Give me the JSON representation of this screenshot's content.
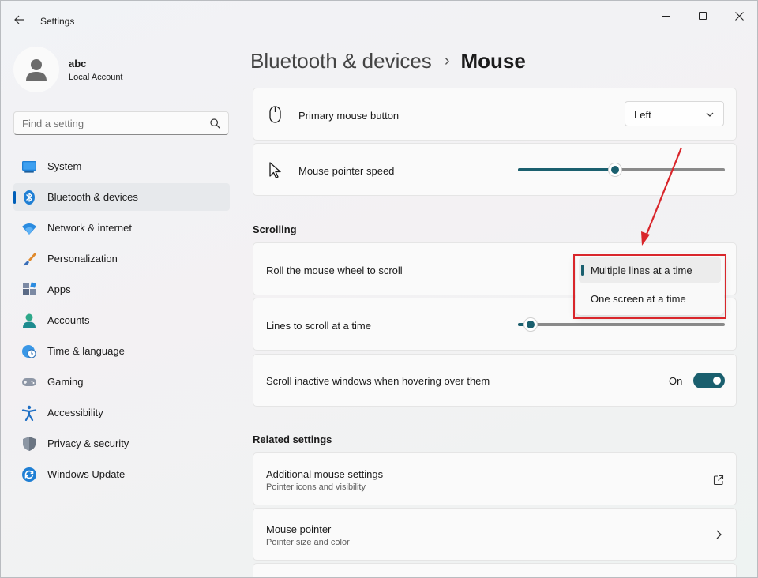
{
  "window": {
    "title": "Settings"
  },
  "profile": {
    "name": "abc",
    "account_type": "Local Account"
  },
  "search": {
    "placeholder": "Find a setting"
  },
  "sidebar": {
    "items": [
      {
        "label": "System",
        "icon": "system-icon",
        "active": false
      },
      {
        "label": "Bluetooth & devices",
        "icon": "bluetooth-icon",
        "active": true
      },
      {
        "label": "Network & internet",
        "icon": "wifi-icon",
        "active": false
      },
      {
        "label": "Personalization",
        "icon": "brush-icon",
        "active": false
      },
      {
        "label": "Apps",
        "icon": "apps-icon",
        "active": false
      },
      {
        "label": "Accounts",
        "icon": "accounts-icon",
        "active": false
      },
      {
        "label": "Time & language",
        "icon": "globe-clock-icon",
        "active": false
      },
      {
        "label": "Gaming",
        "icon": "gamepad-icon",
        "active": false
      },
      {
        "label": "Accessibility",
        "icon": "accessibility-icon",
        "active": false
      },
      {
        "label": "Privacy & security",
        "icon": "shield-icon",
        "active": false
      },
      {
        "label": "Windows Update",
        "icon": "update-icon",
        "active": false
      }
    ]
  },
  "breadcrumb": {
    "parent": "Bluetooth & devices",
    "separator": "›",
    "current": "Mouse"
  },
  "settings": {
    "primary_button": {
      "label": "Primary mouse button",
      "value": "Left"
    },
    "pointer_speed": {
      "label": "Mouse pointer speed",
      "level": 0.47
    },
    "scrolling_heading": "Scrolling",
    "roll_wheel": {
      "label": "Roll the mouse wheel to scroll"
    },
    "lines_to_scroll": {
      "label": "Lines to scroll at a time",
      "level": 0.06
    },
    "scroll_inactive": {
      "label": "Scroll inactive windows when hovering over them",
      "state": "On"
    },
    "related_heading": "Related settings",
    "additional_mouse": {
      "title": "Additional mouse settings",
      "subtitle": "Pointer icons and visibility"
    },
    "mouse_pointer": {
      "title": "Mouse pointer",
      "subtitle": "Pointer size and color"
    }
  },
  "scroll_popup": {
    "options": [
      "Multiple lines at a time",
      "One screen at a time"
    ],
    "selected_index": 0
  },
  "colors": {
    "accent": "#1a5f6e",
    "annotation_red": "#d9262b",
    "nav_indicator": "#005fb8"
  }
}
